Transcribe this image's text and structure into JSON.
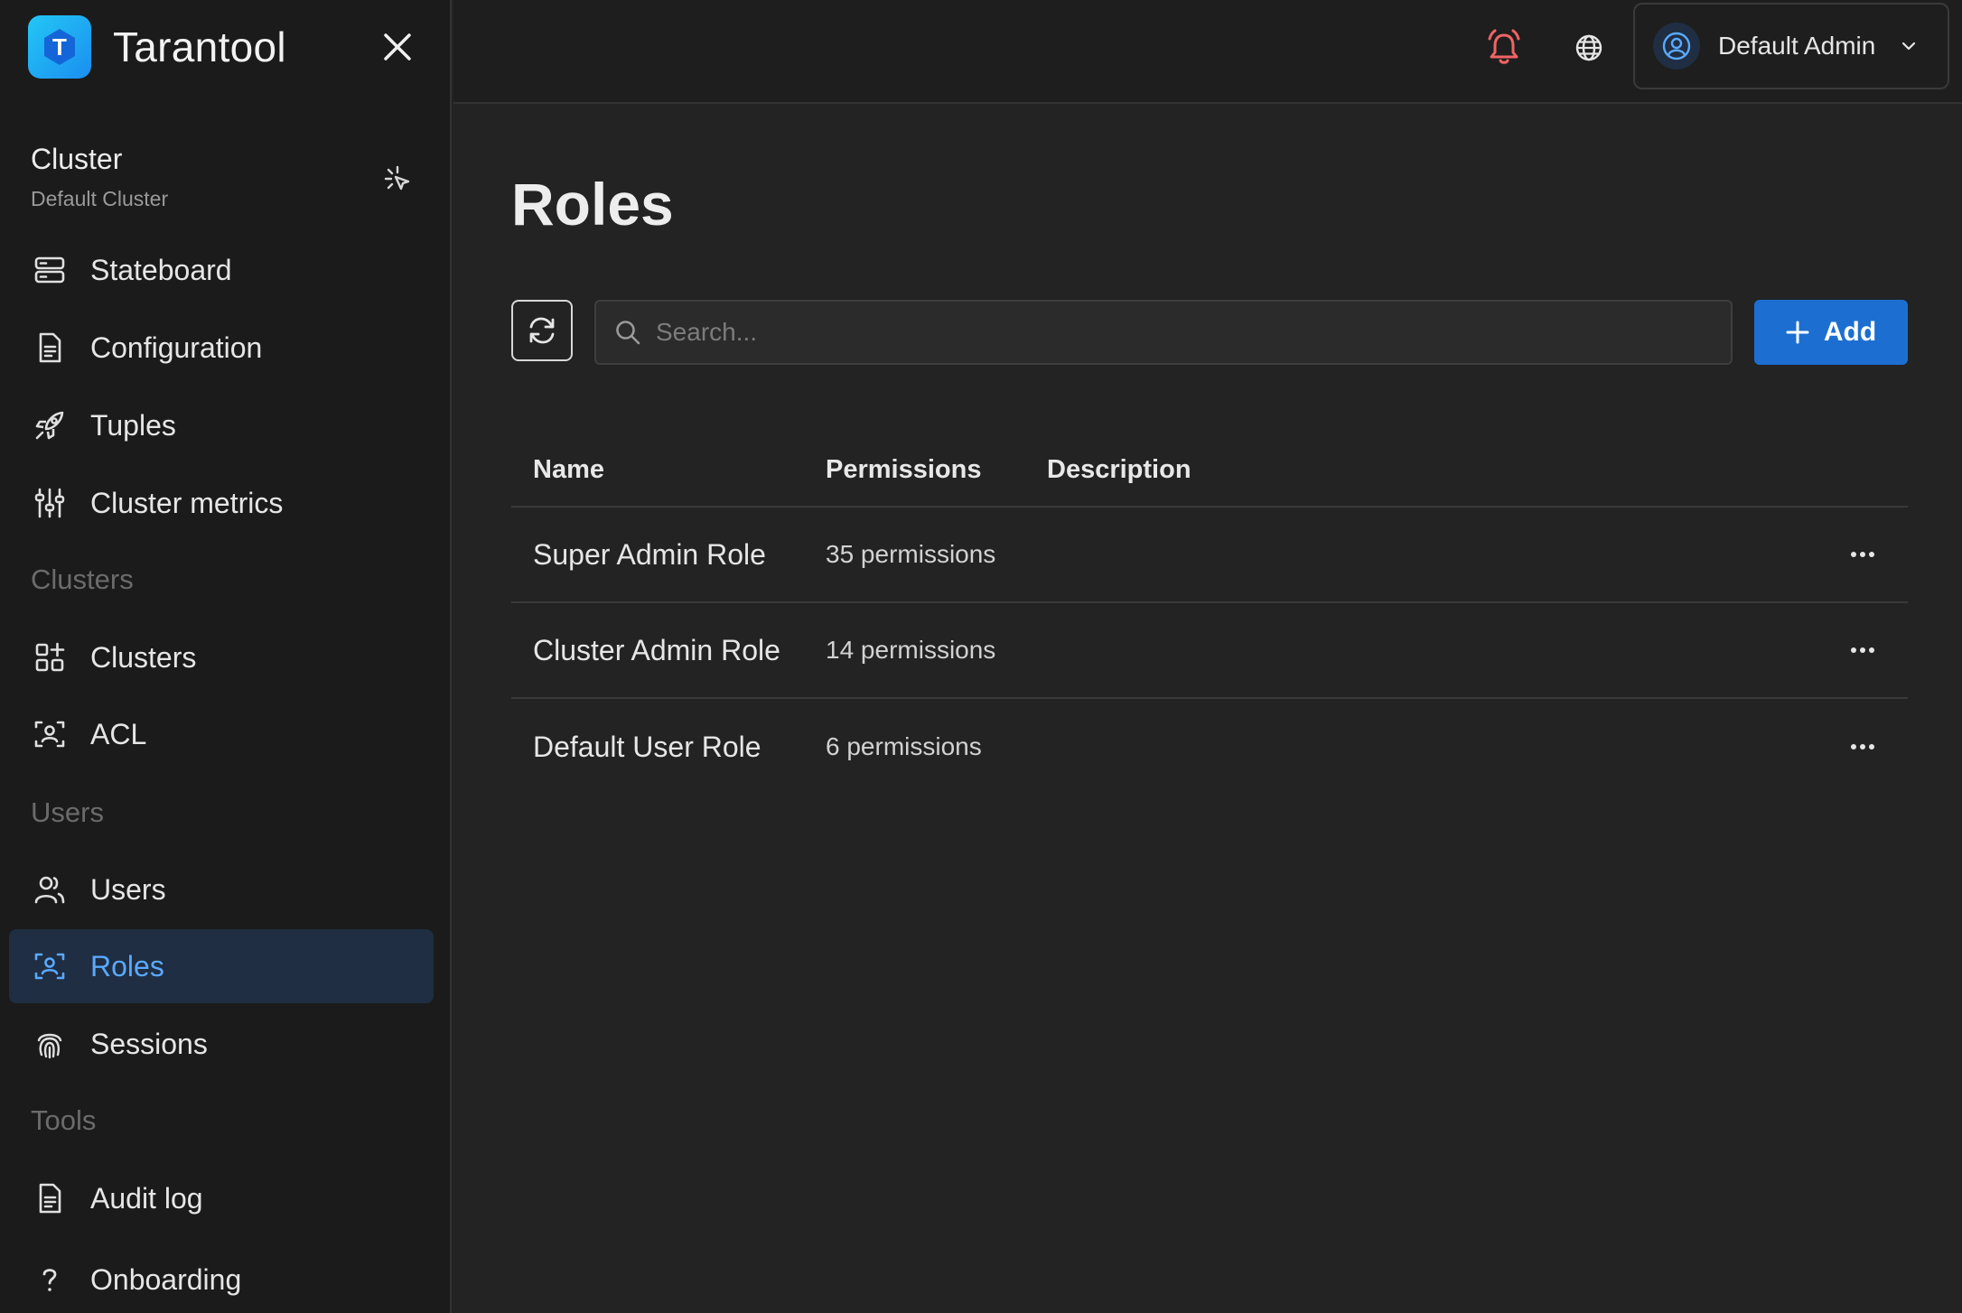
{
  "brand": {
    "name": "Tarantool",
    "logo_letter": "T"
  },
  "cluster": {
    "title": "Cluster",
    "name": "Default Cluster"
  },
  "nav": {
    "cluster_items": [
      {
        "label": "Stateboard",
        "icon": "server-icon"
      },
      {
        "label": "Configuration",
        "icon": "document-icon"
      },
      {
        "label": "Tuples",
        "icon": "rocket-icon"
      },
      {
        "label": "Cluster metrics",
        "icon": "sliders-icon"
      }
    ],
    "clusters_section": "Clusters",
    "clusters_items": [
      {
        "label": "Clusters",
        "icon": "grid-plus-icon"
      },
      {
        "label": "ACL",
        "icon": "user-scan-icon"
      }
    ],
    "users_section": "Users",
    "users_items": [
      {
        "label": "Users",
        "icon": "users-icon"
      },
      {
        "label": "Roles",
        "icon": "user-scan-icon",
        "active": true
      },
      {
        "label": "Sessions",
        "icon": "fingerprint-icon"
      }
    ],
    "tools_section": "Tools",
    "tools_items": [
      {
        "label": "Audit log",
        "icon": "document-icon"
      },
      {
        "label": "Onboarding",
        "icon": "question-icon"
      }
    ]
  },
  "header": {
    "user_name": "Default Admin"
  },
  "page": {
    "title": "Roles",
    "search_placeholder": "Search...",
    "add_label": "Add"
  },
  "table": {
    "columns": [
      "Name",
      "Permissions",
      "Description"
    ],
    "rows": [
      {
        "name": "Super Admin Role",
        "permissions": "35 permissions",
        "description": ""
      },
      {
        "name": "Cluster Admin Role",
        "permissions": "14 permissions",
        "description": ""
      },
      {
        "name": "Default User Role",
        "permissions": "6 permissions",
        "description": ""
      }
    ]
  },
  "colors": {
    "accent": "#1c6fd1",
    "active_text": "#5aa9ff",
    "active_bg": "#1f2e42",
    "bell": "#f06464",
    "logo": "#1b8ef0"
  }
}
